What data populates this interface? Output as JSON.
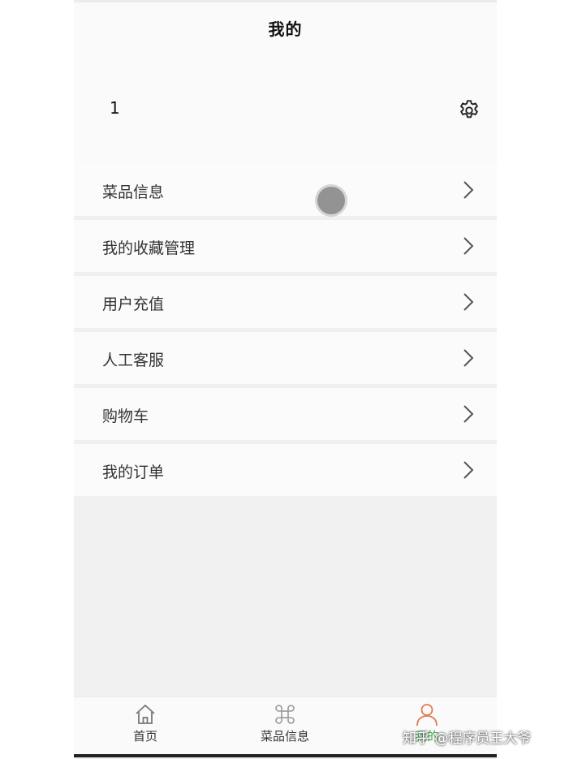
{
  "header": {
    "title": "我的"
  },
  "profile": {
    "username": "1",
    "settings_icon": "gear-icon"
  },
  "menu": {
    "items": [
      {
        "label": "菜品信息",
        "icon": "chevron-right-icon"
      },
      {
        "label": "我的收藏管理",
        "icon": "chevron-right-icon"
      },
      {
        "label": "用户充值",
        "icon": "chevron-right-icon"
      },
      {
        "label": "人工客服",
        "icon": "chevron-right-icon"
      },
      {
        "label": "购物车",
        "icon": "chevron-right-icon"
      },
      {
        "label": "我的订单",
        "icon": "chevron-right-icon"
      }
    ]
  },
  "tabbar": {
    "tabs": [
      {
        "label": "首页",
        "icon": "home-icon"
      },
      {
        "label": "菜品信息",
        "icon": "command-icon"
      },
      {
        "label": "我的",
        "icon": "user-icon"
      }
    ],
    "active_color": "#3aa84a",
    "active_icon_color": "#e07a50"
  },
  "watermark": {
    "text": "知乎 @程序员王大爷"
  }
}
